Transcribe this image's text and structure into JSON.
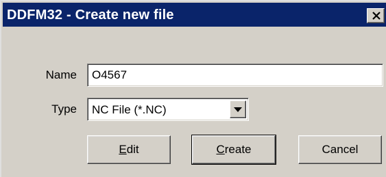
{
  "window": {
    "title": "DDFM32 - Create new file",
    "close_icon": "close-x-icon"
  },
  "form": {
    "name_label": "Name",
    "name_value": "O4567",
    "type_label": "Type",
    "type_value": "NC File (*.NC)",
    "dropdown_icon": "chevron-down-icon"
  },
  "buttons": {
    "edit_mnemonic": "E",
    "edit_rest": "dit",
    "create_mnemonic": "C",
    "create_rest": "reate",
    "cancel_label": "Cancel"
  }
}
